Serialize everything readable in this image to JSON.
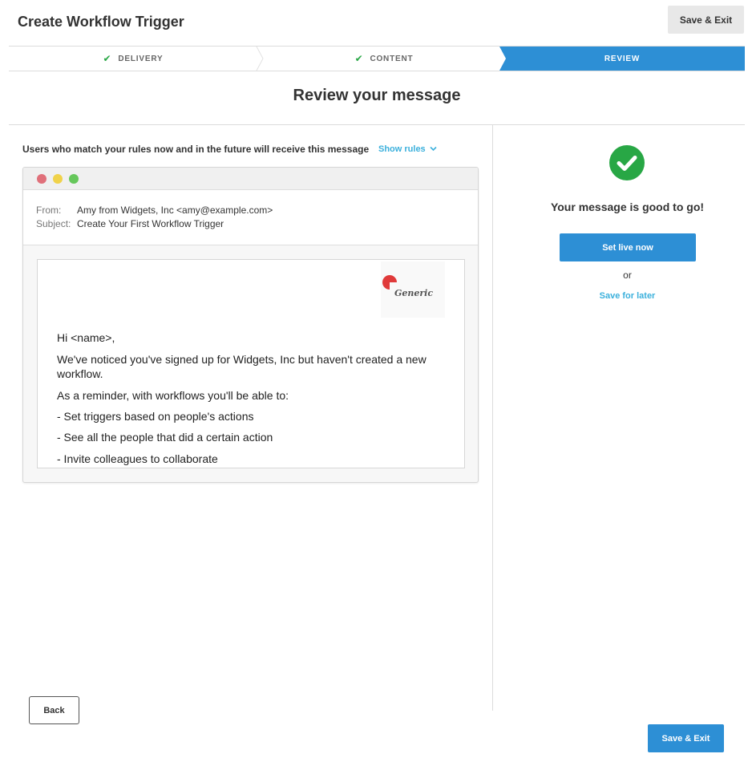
{
  "header": {
    "title": "Create Workflow Trigger",
    "save_exit_label": "Save & Exit"
  },
  "stepper": {
    "steps": [
      {
        "label": "DELIVERY",
        "status": "complete",
        "icon": "check-icon"
      },
      {
        "label": "CONTENT",
        "status": "complete",
        "icon": "check-icon"
      },
      {
        "label": "REVIEW",
        "status": "active"
      }
    ]
  },
  "review": {
    "title": "Review your message",
    "users_text": "Users who match your rules now and in the future will receive this message",
    "show_rules_label": "Show rules"
  },
  "email": {
    "from_label": "From:",
    "from_value": "Amy from Widgets, Inc <amy@example.com>",
    "subject_label": "Subject:",
    "subject_value": "Create Your First Workflow Trigger",
    "logo_text": "Generic",
    "body": [
      "Hi <name>,",
      "We've noticed you've signed up for Widgets, Inc but haven't created a new workflow.",
      "As a reminder, with workflows you'll be able to:",
      "- Set triggers based on people's actions",
      "- See all the people that did a certain action",
      "- Invite colleagues to collaborate"
    ]
  },
  "status": {
    "message": "Your message is good to go!",
    "set_live_label": "Set live now",
    "or_label": "or",
    "save_later_label": "Save for later"
  },
  "footer": {
    "back_label": "Back",
    "save_exit_label": "Save & Exit"
  },
  "colors": {
    "primary": "#2d8fd5",
    "link": "#3bb0dc",
    "success": "#28a745"
  }
}
